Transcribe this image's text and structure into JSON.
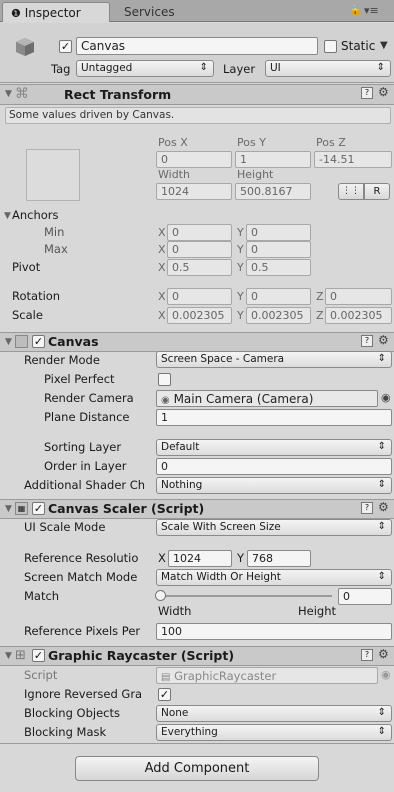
{
  "tabs": {
    "inspector": "Inspector",
    "services": "Services"
  },
  "object": {
    "enabled": true,
    "name": "Canvas",
    "static_label": "Static",
    "tag_label": "Tag",
    "tag_value": "Untagged",
    "layer_label": "Layer",
    "layer_value": "UI"
  },
  "rect_transform": {
    "title": "Rect Transform",
    "note": "Some values driven by Canvas.",
    "pos_x_label": "Pos X",
    "pos_y_label": "Pos Y",
    "pos_z_label": "Pos Z",
    "pos_x": "0",
    "pos_y": "1",
    "pos_z": "-14.51",
    "width_label": "Width",
    "height_label": "Height",
    "width": "1024",
    "height": "500.8167",
    "r_button": "R",
    "anchors_label": "Anchors",
    "min_label": "Min",
    "max_label": "Max",
    "min_x": "0",
    "min_y": "0",
    "max_x": "0",
    "max_y": "0",
    "pivot_label": "Pivot",
    "pivot_x": "0.5",
    "pivot_y": "0.5",
    "rotation_label": "Rotation",
    "rot_x": "0",
    "rot_y": "0",
    "rot_z": "0",
    "scale_label": "Scale",
    "scale_x": "0.002305",
    "scale_y": "0.002305",
    "scale_z": "0.002305",
    "x": "X",
    "y": "Y",
    "z": "Z"
  },
  "canvas": {
    "title": "Canvas",
    "enabled": true,
    "render_mode_label": "Render Mode",
    "render_mode": "Screen Space - Camera",
    "pixel_perfect_label": "Pixel Perfect",
    "render_camera_label": "Render Camera",
    "render_camera": "Main Camera (Camera)",
    "plane_distance_label": "Plane Distance",
    "plane_distance": "1",
    "sorting_layer_label": "Sorting Layer",
    "sorting_layer": "Default",
    "order_label": "Order in Layer",
    "order": "0",
    "shader_label": "Additional Shader Ch",
    "shader": "Nothing"
  },
  "scaler": {
    "title": "Canvas Scaler (Script)",
    "ui_scale_label": "UI Scale Mode",
    "ui_scale": "Scale With Screen Size",
    "ref_res_label": "Reference Resolutio",
    "ref_x": "1024",
    "ref_y": "768",
    "match_mode_label": "Screen Match Mode",
    "match_mode": "Match Width Or Height",
    "match_label": "Match",
    "match_value": "0",
    "match_fraction": 0,
    "width_text": "Width",
    "height_text": "Height",
    "ppu_label": "Reference Pixels Per",
    "ppu": "100"
  },
  "raycaster": {
    "title": "Graphic Raycaster (Script)",
    "script_label": "Script",
    "script": "GraphicRaycaster",
    "ignore_label": "Ignore Reversed Gra",
    "blocking_objects_label": "Blocking Objects",
    "blocking_objects": "None",
    "blocking_mask_label": "Blocking Mask",
    "blocking_mask": "Everything"
  },
  "add_component": "Add Component",
  "colors": {
    "header": "#c9c9c9",
    "background": "#d8d8d8",
    "tab_bar": "#a8a8a8"
  }
}
